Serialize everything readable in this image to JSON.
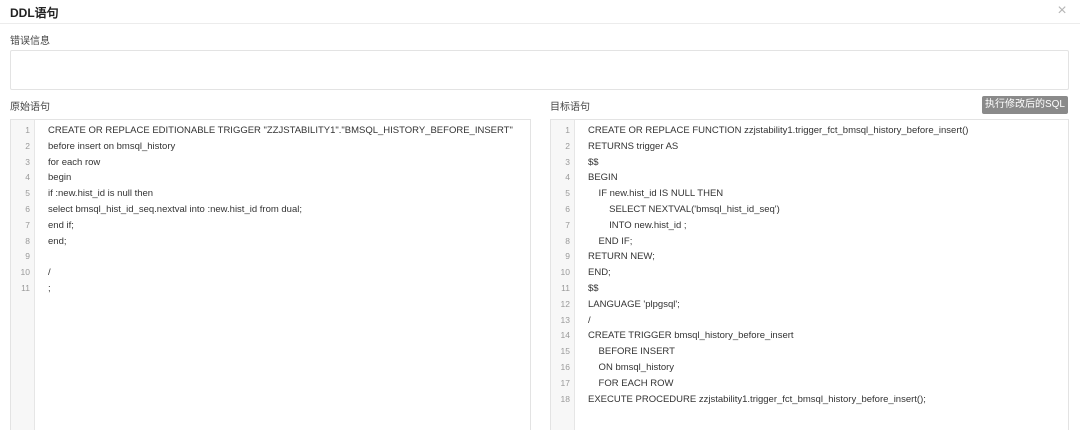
{
  "dialog": {
    "title": "DDL语句",
    "close_icon": "×"
  },
  "error": {
    "label": "错误信息",
    "value": ""
  },
  "original": {
    "label": "原始语句",
    "lines": [
      "CREATE OR REPLACE EDITIONABLE TRIGGER \"ZZJSTABILITY1\".\"BMSQL_HISTORY_BEFORE_INSERT\"",
      "before insert on bmsql_history",
      "for each row",
      "begin",
      "if :new.hist_id is null then",
      "select bmsql_hist_id_seq.nextval into :new.hist_id from dual;",
      "end if;",
      "end;",
      "",
      "/",
      ";"
    ]
  },
  "target": {
    "label": "目标语句",
    "button_label": "执行修改后的SQL",
    "lines": [
      "CREATE OR REPLACE FUNCTION zzjstability1.trigger_fct_bmsql_history_before_insert()",
      "RETURNS trigger AS",
      "$$",
      "BEGIN",
      "    IF new.hist_id IS NULL THEN",
      "        SELECT NEXTVAL('bmsql_hist_id_seq')",
      "        INTO new.hist_id ;",
      "    END IF;",
      "RETURN NEW;",
      "END;",
      "$$",
      "LANGUAGE 'plpgsql';",
      "/",
      "CREATE TRIGGER bmsql_history_before_insert",
      "    BEFORE INSERT",
      "    ON bmsql_history",
      "    FOR EACH ROW",
      "EXECUTE PROCEDURE zzjstability1.trigger_fct_bmsql_history_before_insert();"
    ]
  }
}
